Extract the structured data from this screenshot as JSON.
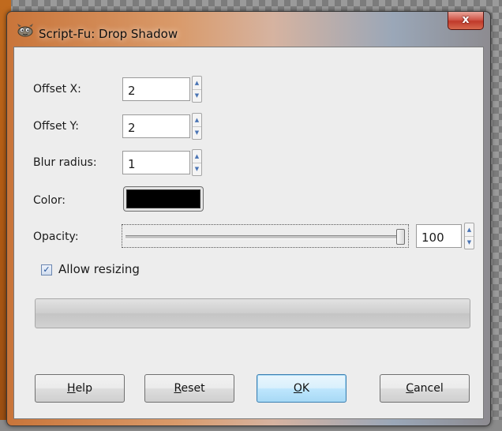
{
  "window": {
    "title": "Script-Fu: Drop Shadow",
    "close_symbol": "x",
    "icon": "gimp-icon"
  },
  "fields": {
    "offset_x": {
      "label": "Offset X:",
      "value": "2"
    },
    "offset_y": {
      "label": "Offset Y:",
      "value": "2"
    },
    "blur_radius": {
      "label": "Blur radius:",
      "value": "1"
    },
    "color": {
      "label": "Color:",
      "value": "#000000"
    },
    "opacity": {
      "label": "Opacity:",
      "value": "100",
      "level": 1.0
    }
  },
  "allow_resizing": {
    "label": "Allow resizing",
    "checked": true
  },
  "progress": {
    "fraction": 0.0
  },
  "buttons": {
    "help": {
      "mnemonic": "H",
      "rest": "elp"
    },
    "reset": {
      "mnemonic": "R",
      "rest": "eset"
    },
    "ok": {
      "mnemonic": "O",
      "rest": "K"
    },
    "cancel": {
      "mnemonic": "C",
      "rest": "ancel"
    }
  },
  "colors": {
    "dialog_bg": "#ededed",
    "default_button_border": "#3c7fb1",
    "close_button": "#c03a2b"
  }
}
